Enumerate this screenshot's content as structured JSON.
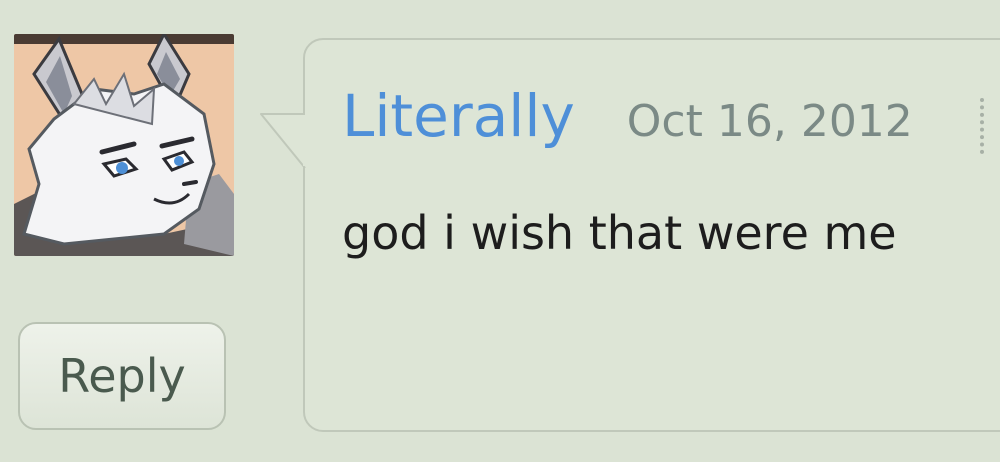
{
  "post": {
    "username": "Literally",
    "date": "Oct 16, 2012",
    "message": "god i wish that were me"
  },
  "actions": {
    "reply_label": "Reply"
  },
  "avatar": {
    "icon": "wolf-avatar-icon"
  },
  "colors": {
    "background": "#dbe3d4",
    "username": "#4e8fd8",
    "date": "#7b8a86",
    "bubble": "#dde5d6",
    "bubble_border": "#c0c8ba"
  }
}
